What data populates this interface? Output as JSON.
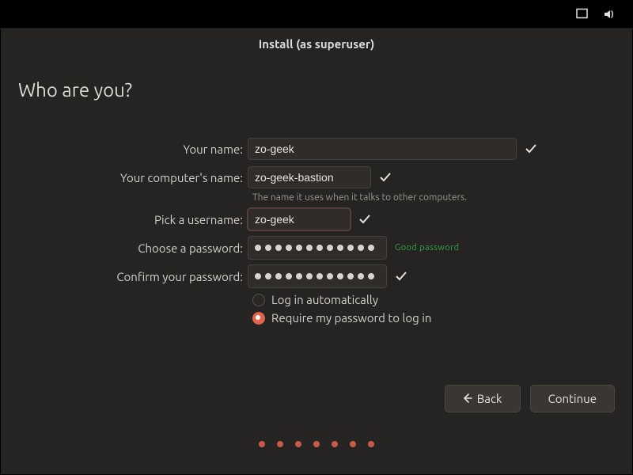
{
  "window_title": "Install (as superuser)",
  "page_heading": "Who are you?",
  "labels": {
    "name": "Your name:",
    "computer": "Your computer's name:",
    "computer_hint": "The name it uses when it talks to other computers.",
    "username": "Pick a username:",
    "password": "Choose a password:",
    "confirm": "Confirm your password:"
  },
  "values": {
    "name": "zo-geek",
    "computer": "zo-geek-bastion",
    "username": "zo-geek"
  },
  "password_strength": "Good password",
  "radios": {
    "auto": "Log in automatically",
    "require": "Require my password to log in"
  },
  "buttons": {
    "back": "Back",
    "continue": "Continue"
  }
}
